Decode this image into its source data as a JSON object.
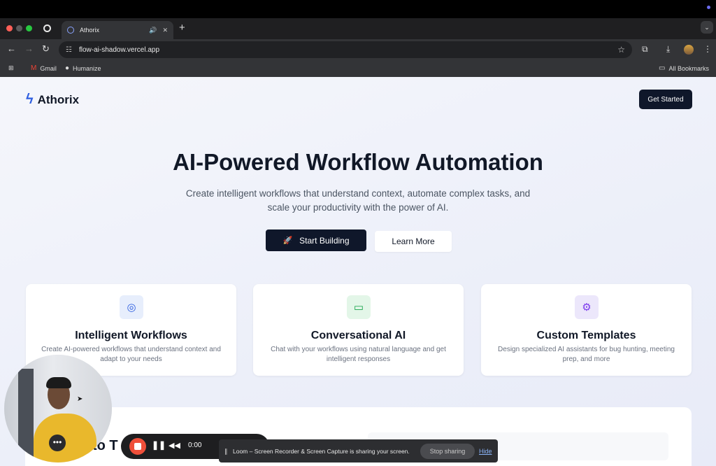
{
  "browser": {
    "tab": {
      "title": "Athorix"
    },
    "url": "flow-ai-shadow.vercel.app",
    "bookmarks": [
      {
        "label": "Gmail",
        "icon": "gmail-icon"
      },
      {
        "label": "Humanize",
        "icon": "github-icon"
      }
    ],
    "all_bookmarks_label": "All Bookmarks"
  },
  "site": {
    "brand": "Athorix",
    "header_cta": "Get Started",
    "hero": {
      "title": "AI-Powered Workflow Automation",
      "subtitle": "Create intelligent workflows that understand context, automate complex tasks, and scale your productivity with the power of AI.",
      "primary_cta": "Start Building",
      "secondary_cta": "Learn More"
    },
    "features": [
      {
        "title": "Intelligent Workflows",
        "description": "Create AI-powered workflows that understand context and adapt to your needs",
        "icon": "brain-icon",
        "accent": "#2f5fe0",
        "bg": "#e7eefc"
      },
      {
        "title": "Conversational AI",
        "description": "Chat with your workflows using natural language and get intelligent responses",
        "icon": "chat-icon",
        "accent": "#16a34a",
        "bg": "#e3f6e8"
      },
      {
        "title": "Custom Templates",
        "description": "Design specialized AI assistants for bug hunting, meeting prep, and more",
        "icon": "gear-icon",
        "accent": "#7c3aed",
        "bg": "#ece7fb"
      }
    ],
    "bottom_section_partial_title": "to T"
  },
  "overlays": {
    "recorder_time": "0:00",
    "share_message": "Loom – Screen Recorder & Screen Capture is sharing your screen.",
    "stop_sharing": "Stop sharing",
    "hide": "Hide",
    "webcam_more": "•••"
  }
}
